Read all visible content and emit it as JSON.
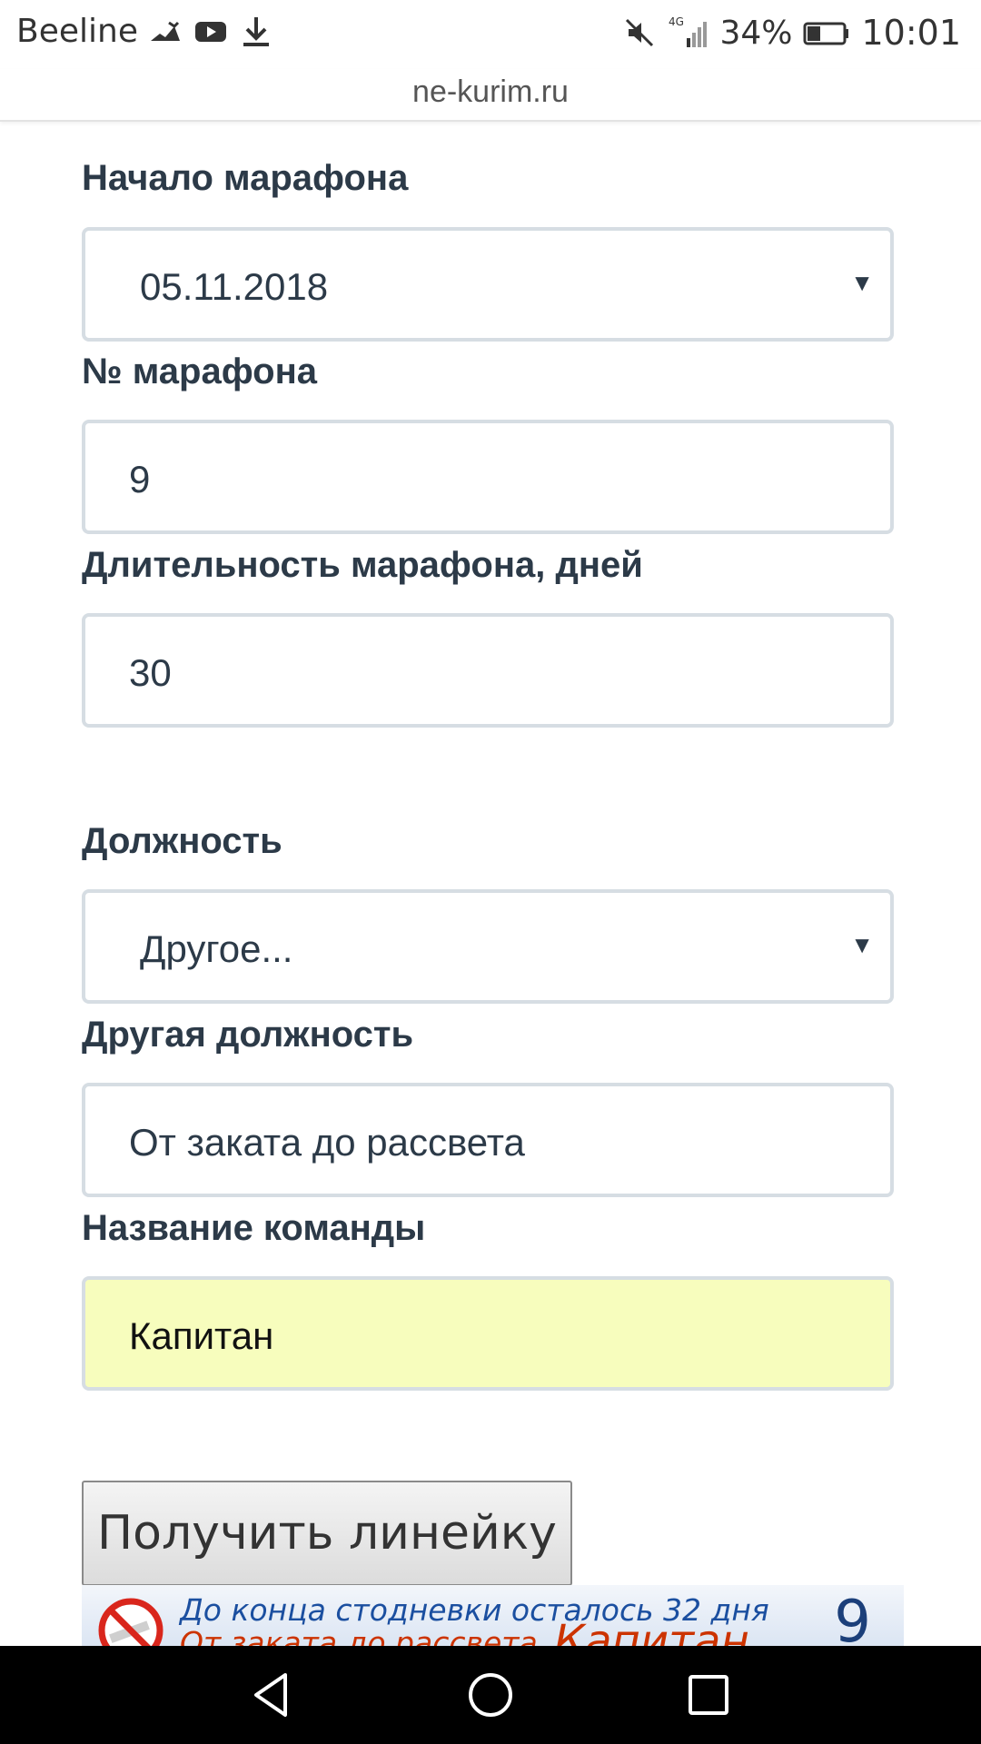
{
  "statusbar": {
    "carrier": "Beeline",
    "battery_percent": "34%",
    "time": "10:01",
    "network": "4G",
    "icons": [
      "activity-icon",
      "youtube-icon",
      "download-icon",
      "mute-icon",
      "signal-icon",
      "battery-icon"
    ]
  },
  "browser": {
    "url": "ne-kurim.ru"
  },
  "form": {
    "start_label": "Начало марафона",
    "start_value": "05.11.2018",
    "number_label": "№ марафона",
    "number_value": "9",
    "duration_label": "Длительность марафона, дней",
    "duration_value": "30",
    "position_label": "Должность",
    "position_value": "Другое...",
    "other_position_label": "Другая должность",
    "other_position_value": "От заката до рассвета",
    "team_label": "Название команды",
    "team_value": "Капитан",
    "submit_label": "Получить линейку"
  },
  "banner": {
    "line1": "До конца стодневки осталось 32 дня",
    "line2": "От заката до рассвета",
    "captain": "Капитан",
    "number": "9"
  },
  "colors": {
    "label": "#2c3a48",
    "field_border": "#d6dde3",
    "highlight": "#f7fdbd"
  }
}
